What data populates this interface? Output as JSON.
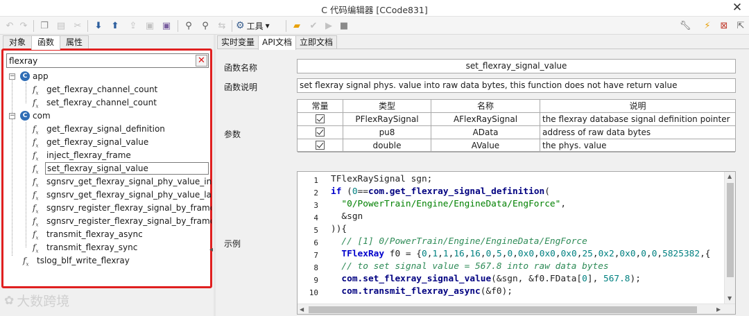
{
  "window": {
    "title": "C 代码编辑器 [CCode831]",
    "close_glyph": "✕"
  },
  "toolbar": {
    "tools_label": "工具",
    "tools_arrow": "▾"
  },
  "left_tabs": [
    "对象",
    "函数",
    "属性"
  ],
  "search": {
    "value": "flexray",
    "clear_glyph": "✕"
  },
  "tree": {
    "groups": [
      {
        "name": "app",
        "items": [
          "get_flexray_channel_count",
          "set_flexray_channel_count"
        ]
      },
      {
        "name": "com",
        "items": [
          "get_flexray_signal_definition",
          "get_flexray_signal_value",
          "inject_flexray_frame",
          "set_flexray_signal_value",
          "sgnsrv_get_flexray_signal_phy_value_in_fr",
          "sgnsrv_get_flexray_signal_phy_value_lates",
          "sgnsrv_register_flexray_signal_by_frame",
          "sgnsrv_register_flexray_signal_by_frame_n",
          "transmit_flexray_async",
          "transmit_flexray_sync"
        ]
      }
    ],
    "root_items": [
      "tslog_blf_write_flexray"
    ],
    "selected": "set_flexray_signal_value"
  },
  "watermark": "大数跨境",
  "right_tabs": [
    "实时变量",
    "API文档",
    "立即文档"
  ],
  "doc": {
    "name_label": "函数名称",
    "name_value": "set_flexray_signal_value",
    "desc_label": "函数说明",
    "desc_value": "set flexray signal phys. value into raw data bytes, this function does not have return value",
    "params_label": "参数",
    "example_label": "示例",
    "param_headers": [
      "常量",
      "类型",
      "名称",
      "说明"
    ],
    "params": [
      {
        "const": true,
        "type": "PFlexRaySignal",
        "name": "AFlexRaySignal",
        "desc": "the flexray database signal definition pointer"
      },
      {
        "const": true,
        "type": "pu8",
        "name": "AData",
        "desc": "address of raw data bytes"
      },
      {
        "const": true,
        "type": "double",
        "name": "AValue",
        "desc": "the phys. value"
      }
    ]
  },
  "code_lines": [
    "TFlexRaySignal sgn;",
    "if (0==com.get_flexray_signal_definition(",
    "  \"0/PowerTrain/Engine/EngineData/EngForce\",",
    "  &sgn",
    ")){",
    "  // [1] 0/PowerTrain/Engine/EngineData/EngForce",
    "  TFlexRay f0 = {0,1,1,16,16,0,5,0,0x0,0x0,0x0,25,0x2,0x0,0,0,5825382,{",
    "  // to set signal value = 567.8 into raw data bytes",
    "  com.set_flexray_signal_value(&sgn, &f0.FData[0], 567.8);",
    "  com.transmit_flexray_async(&f0);"
  ]
}
